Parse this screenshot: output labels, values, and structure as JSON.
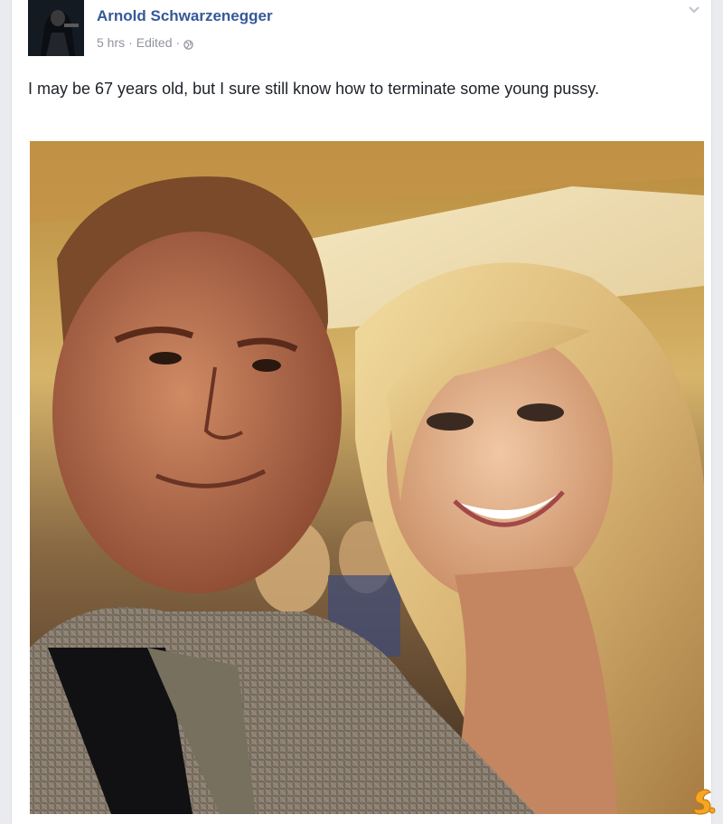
{
  "post": {
    "author": "Arnold Schwarzenegger",
    "time": "5 hrs",
    "separator": "·",
    "edited": "Edited",
    "separator_2": "·",
    "audience_icon": "globe-icon",
    "menu_icon": "chevron-down-icon",
    "text": "I may be 67 years old, but I sure still know how to terminate some young pussy.",
    "photo_icon": "selfie-photo"
  },
  "watermark": {
    "icon": "logo-badge-icon"
  },
  "colors": {
    "author_link": "#365899",
    "meta_text": "#90949c",
    "body_text": "#1d2129",
    "page_bg": "#e9ebee"
  }
}
